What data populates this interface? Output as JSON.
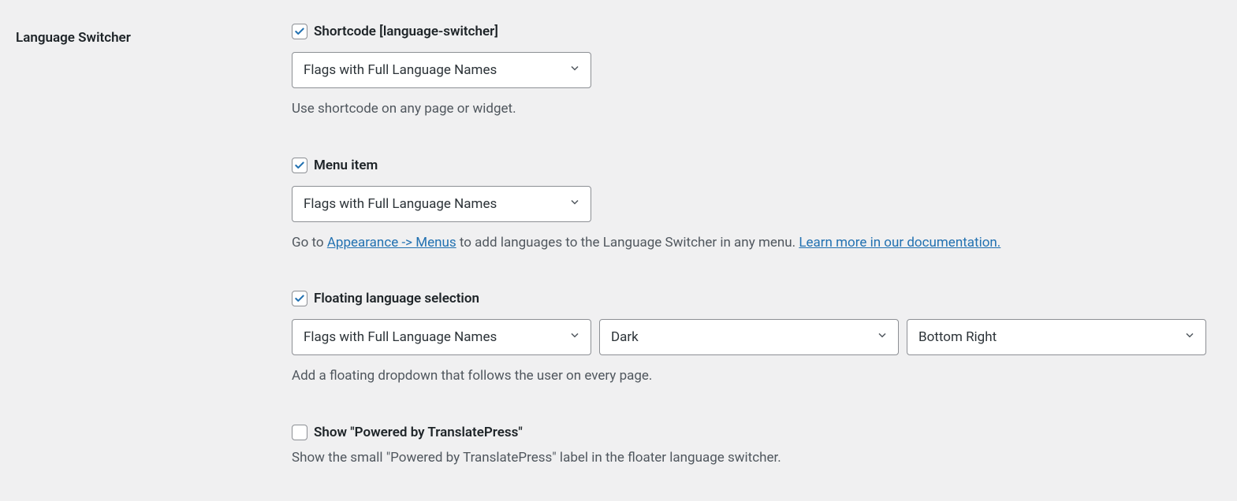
{
  "section_title": "Language Switcher",
  "shortcode": {
    "checked": true,
    "label": "Shortcode [language-switcher]",
    "select_value": "Flags with Full Language Names",
    "description": "Use shortcode on any page or widget."
  },
  "menu_item": {
    "checked": true,
    "label": "Menu item",
    "select_value": "Flags with Full Language Names",
    "desc_pre": "Go to ",
    "desc_link1": "Appearance -> Menus",
    "desc_mid": " to add languages to the Language Switcher in any menu. ",
    "desc_link2": "Learn more in our documentation."
  },
  "floating": {
    "checked": true,
    "label": "Floating language selection",
    "select_value": "Flags with Full Language Names",
    "theme_value": "Dark",
    "position_value": "Bottom Right",
    "description": "Add a floating dropdown that follows the user on every page."
  },
  "powered": {
    "checked": false,
    "label": "Show \"Powered by TranslatePress\"",
    "description": "Show the small \"Powered by TranslatePress\" label in the floater language switcher."
  }
}
